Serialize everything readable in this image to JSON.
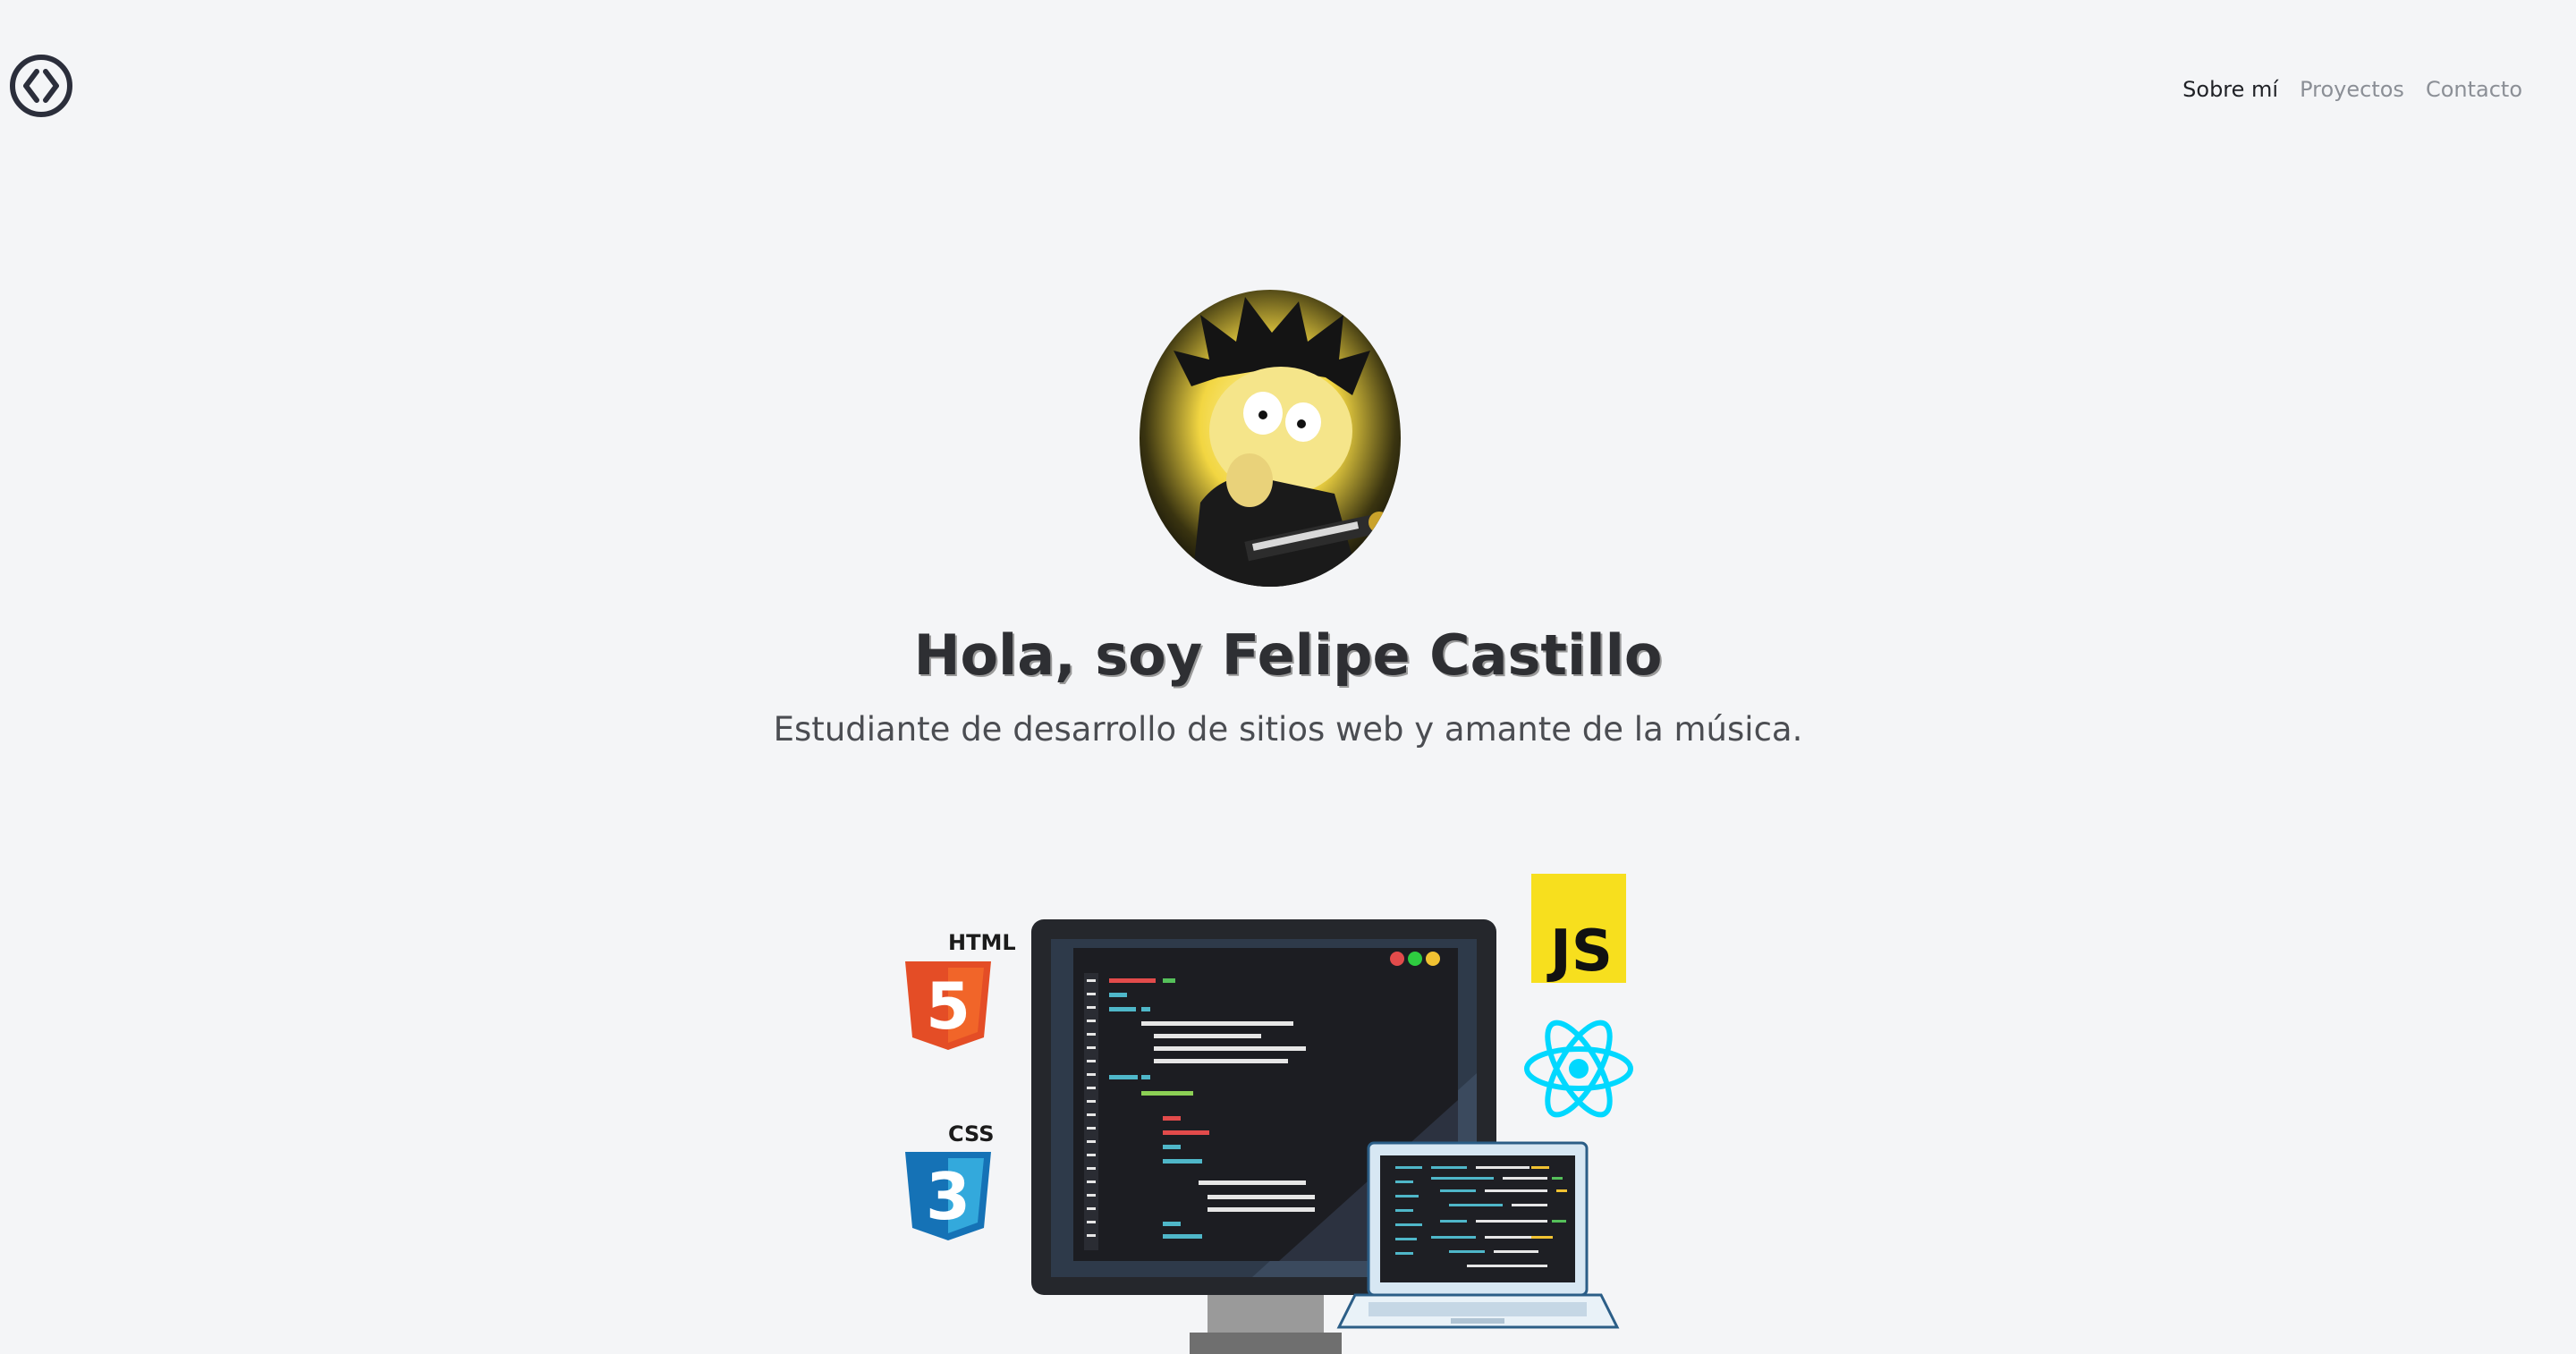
{
  "header": {
    "logo_icon": "code-brackets-circle-icon",
    "nav": [
      {
        "label": "Sobre mí",
        "active": true
      },
      {
        "label": "Proyectos",
        "active": false
      },
      {
        "label": "Contacto",
        "active": false
      }
    ]
  },
  "hero": {
    "avatar_icon": "cartoon-guitarist-avatar",
    "title": "Hola, soy Felipe Castillo",
    "subtitle": "Estudiante de desarrollo de sitios web y amante de la música."
  },
  "illustration": {
    "badges": {
      "html": "HTML",
      "html_number": "5",
      "css": "CSS",
      "css_number": "3",
      "js": "JS"
    },
    "icons": [
      "html5-icon",
      "css3-icon",
      "javascript-icon",
      "react-icon",
      "monitor-icon",
      "laptop-icon"
    ],
    "colors": {
      "html": "#e44d26",
      "css": "#1572b6",
      "js": "#f7df1e",
      "react": "#00d8ff"
    }
  }
}
